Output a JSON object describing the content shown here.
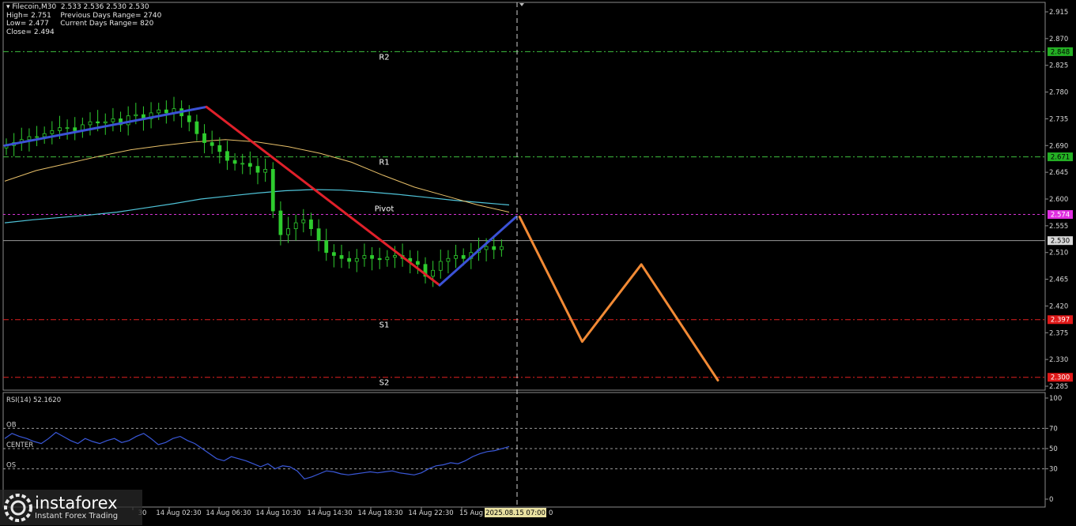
{
  "info": {
    "symbol_line": "Filecoin,M30  2.533 2.536 2.530 2.530",
    "high": "High= 2.751",
    "prev_range": "Previous Days Range= 2740",
    "low": "Low= 2.477",
    "curr_range": "Current Days Range= 820",
    "close": "Close= 2.494"
  },
  "colors": {
    "bull": "#2ecc2e",
    "up_trend": "#3b52d6",
    "down_trend": "#e0202a",
    "forecast": "#f28a35",
    "ma_slow": "#4fc3d8",
    "ma_fast": "#e8c069",
    "resistance": "#3fbf3f",
    "pivot": "#d633d6",
    "support": "#e02020",
    "rsi": "#3a58d9"
  },
  "levels": [
    {
      "name": "R2",
      "value": 2.848,
      "label": "2.848",
      "kind": "resistance"
    },
    {
      "name": "R1",
      "value": 2.671,
      "label": "2.671",
      "kind": "resistance"
    },
    {
      "name": "Pivot",
      "value": 2.574,
      "label": "2.574",
      "kind": "pivot"
    },
    {
      "name": "S1",
      "value": 2.397,
      "label": "2.397",
      "kind": "support"
    },
    {
      "name": "S2",
      "value": 2.3,
      "label": "2.300",
      "kind": "support"
    }
  ],
  "chart_data": [
    {
      "type": "candlestick",
      "ylim": [
        2.285,
        2.925
      ],
      "y_ticks": [
        "2.915",
        "2.870",
        "2.825",
        "2.780",
        "2.735",
        "2.690",
        "2.645",
        "2.600",
        "2.555",
        "2.510",
        "2.465",
        "2.420",
        "2.375",
        "2.330",
        "2.285"
      ],
      "current_price": "2.530",
      "x_ticks": [
        "30",
        "14 Aug 02:30",
        "14 Aug 06:30",
        "14 Aug 10:30",
        "14 Aug 14:30",
        "14 Aug 18:30",
        "14 Aug 22:30",
        "15 Aug"
      ],
      "cursor_time": "2025.08.15 07:00",
      "cursor_tail": "0",
      "close_series": [
        2.69,
        2.695,
        2.7,
        2.705,
        2.705,
        2.71,
        2.715,
        2.72,
        2.72,
        2.715,
        2.725,
        2.73,
        2.728,
        2.73,
        2.735,
        2.725,
        2.74,
        2.742,
        2.735,
        2.745,
        2.75,
        2.745,
        2.752,
        2.74,
        2.73,
        2.71,
        2.695,
        2.69,
        2.68,
        2.665,
        2.66,
        2.66,
        2.655,
        2.645,
        2.65,
        2.58,
        2.54,
        2.55,
        2.56,
        2.565,
        2.55,
        2.53,
        2.51,
        2.505,
        2.5,
        2.495,
        2.5,
        2.505,
        2.5,
        2.498,
        2.502,
        2.505,
        2.5,
        2.495,
        2.49,
        2.47,
        2.48,
        2.495,
        2.5,
        2.505,
        2.5,
        2.51,
        2.515,
        2.52,
        2.515,
        2.52
      ],
      "ma_fast": [
        2.63,
        2.648,
        2.66,
        2.672,
        2.683,
        2.69,
        2.696,
        2.7,
        2.696,
        2.688,
        2.677,
        2.662,
        2.64,
        2.62,
        2.605,
        2.59,
        2.578
      ],
      "ma_slow": [
        2.56,
        2.565,
        2.569,
        2.573,
        2.578,
        2.585,
        2.592,
        2.6,
        2.605,
        2.61,
        2.614,
        2.616,
        2.615,
        2.612,
        2.608,
        2.603,
        2.598,
        2.594,
        2.59
      ],
      "trend_up_1": [
        [
          0,
          2.69
        ],
        [
          58,
          2.755
        ]
      ],
      "trend_down": [
        [
          58,
          2.755
        ],
        [
          125,
          2.455
        ]
      ],
      "trend_up_2": [
        [
          125,
          2.455
        ],
        [
          147,
          2.57
        ]
      ],
      "forecast": [
        [
          148,
          2.57
        ],
        [
          166,
          2.36
        ],
        [
          183,
          2.49
        ],
        [
          205,
          2.295
        ]
      ]
    },
    {
      "type": "line",
      "title": "RSI(14) 52.1620",
      "ylim": [
        0,
        100
      ],
      "y_ticks": [
        "100",
        "70",
        "50",
        "30",
        "0"
      ],
      "bands": [
        {
          "label": "OB",
          "value": 70
        },
        {
          "label": "CENTER",
          "value": 50
        },
        {
          "label": "OS",
          "value": 30
        }
      ],
      "values": [
        60,
        65,
        62,
        60,
        57,
        55,
        60,
        66,
        62,
        58,
        55,
        60,
        57,
        55,
        58,
        60,
        56,
        58,
        62,
        65,
        60,
        54,
        56,
        60,
        62,
        58,
        55,
        50,
        45,
        40,
        38,
        42,
        40,
        38,
        35,
        32,
        35,
        30,
        33,
        32,
        28,
        20,
        22,
        25,
        28,
        27,
        25,
        24,
        25,
        26,
        27,
        26,
        27,
        28,
        26,
        25,
        24,
        26,
        30,
        33,
        34,
        36,
        35,
        38,
        42,
        45,
        47,
        48,
        50,
        52
      ]
    }
  ],
  "watermark": {
    "brand": "instaforex",
    "tagline": "Instant Forex Trading"
  }
}
